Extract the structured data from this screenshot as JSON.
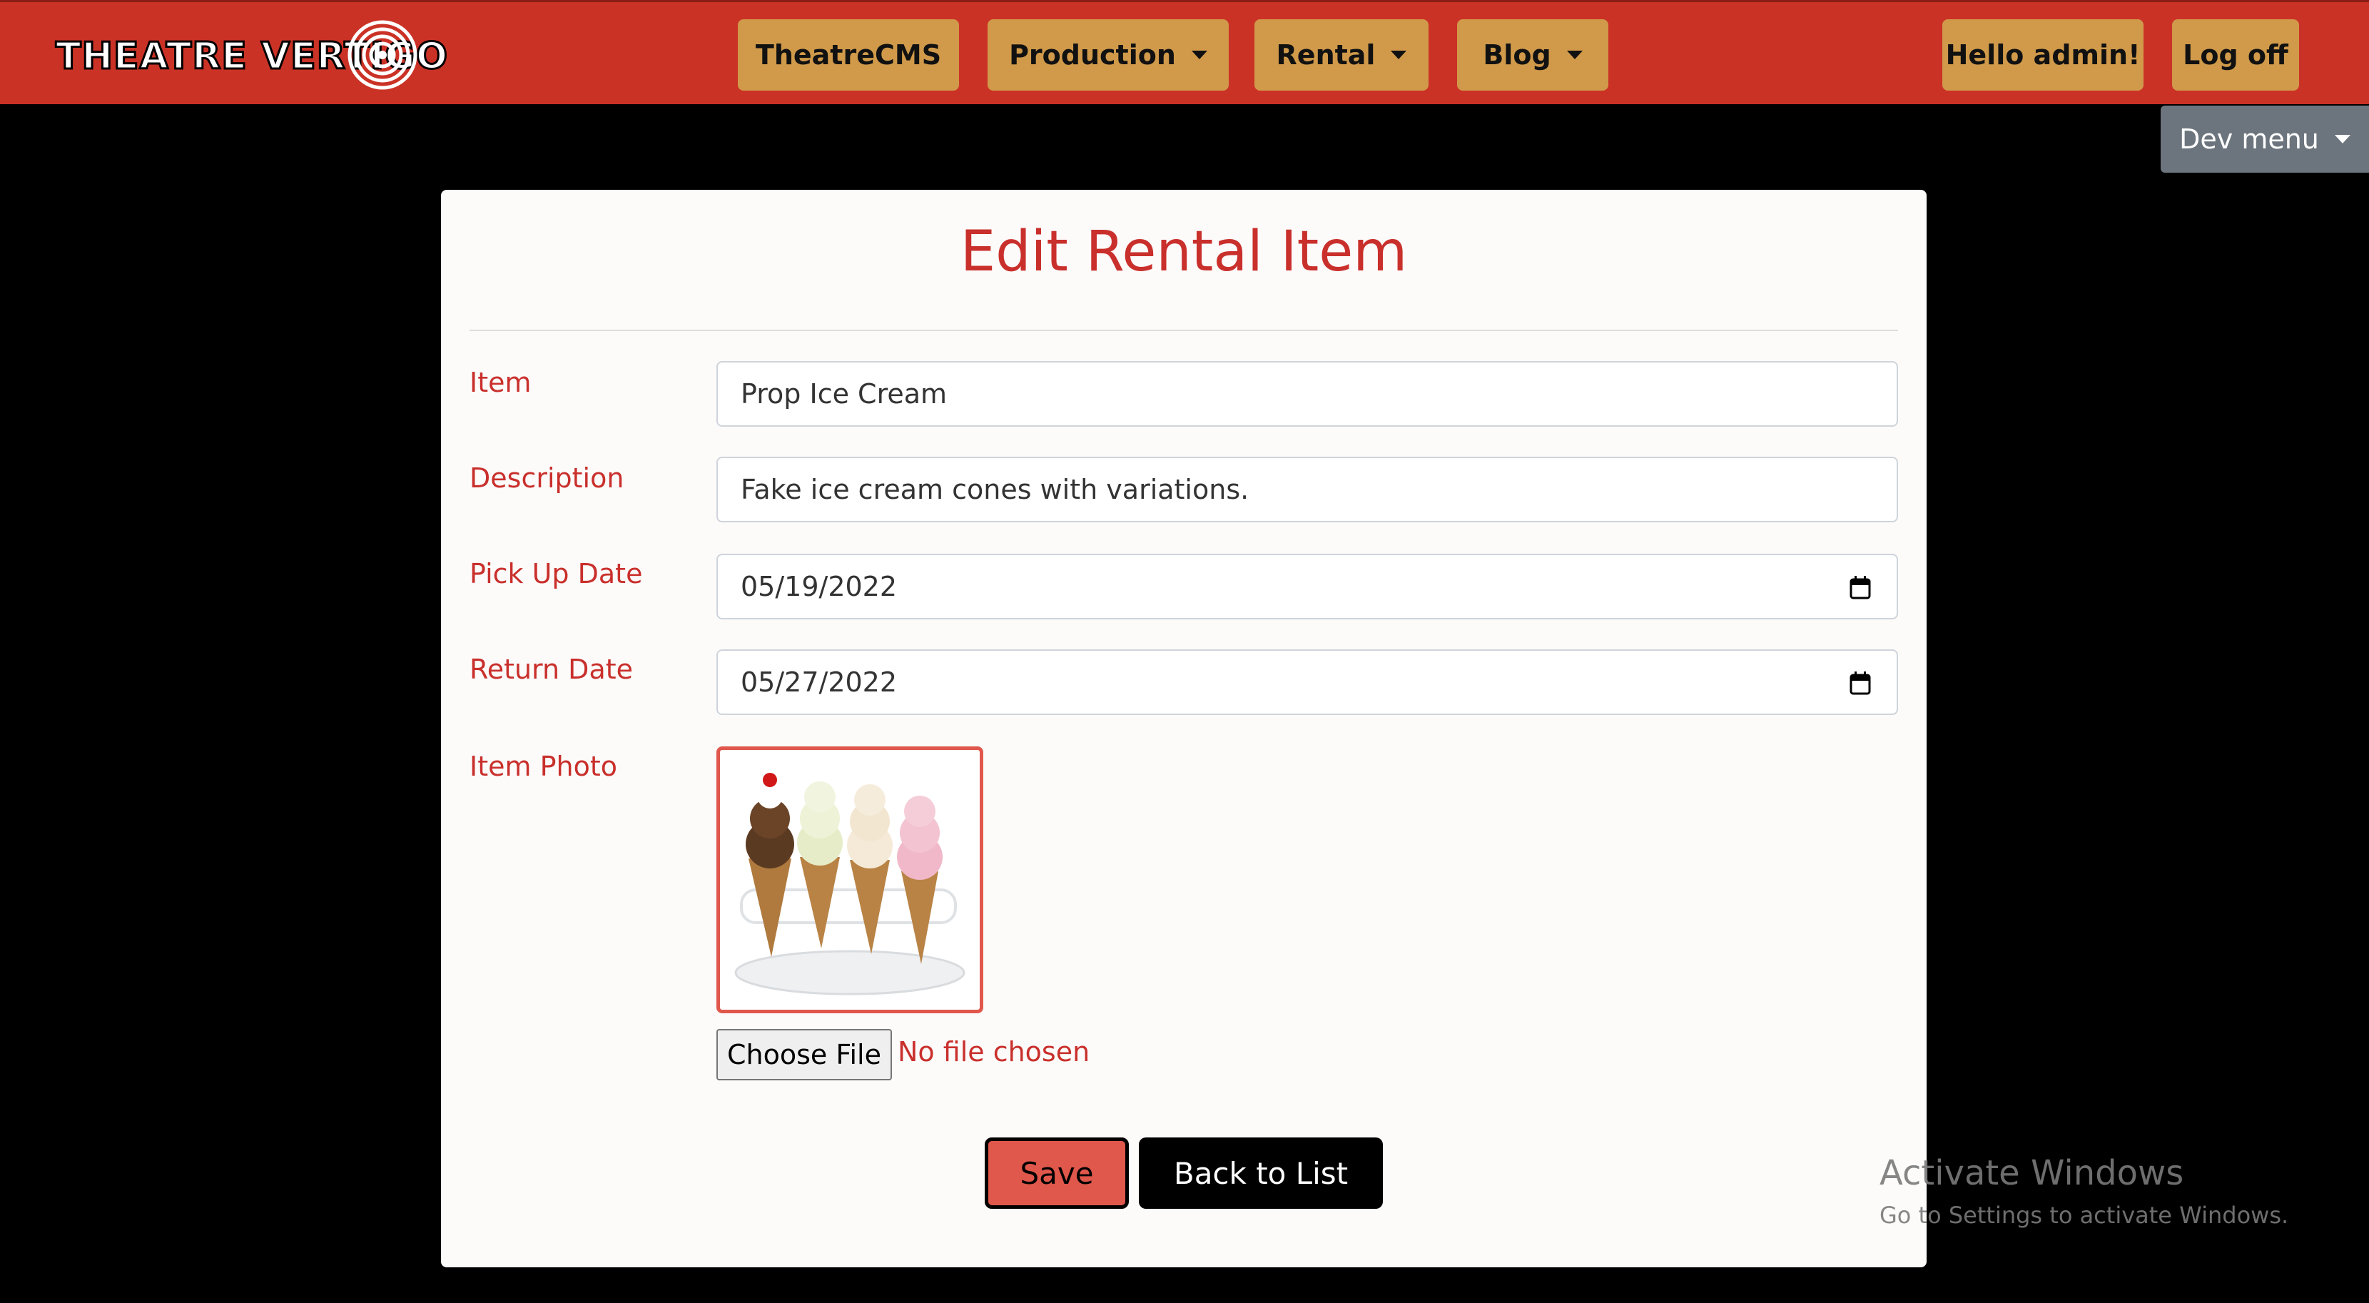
{
  "brand": {
    "logo_text": "THEATRE VERTIGO"
  },
  "nav": {
    "items": [
      {
        "label": "TheatreCMS",
        "dropdown": false
      },
      {
        "label": "Production",
        "dropdown": true
      },
      {
        "label": "Rental",
        "dropdown": true
      },
      {
        "label": "Blog",
        "dropdown": true
      }
    ],
    "greeting": "Hello admin!",
    "logoff": "Log off",
    "dev_menu": "Dev menu"
  },
  "form": {
    "title": "Edit Rental Item",
    "fields": {
      "item": {
        "label": "Item",
        "value": "Prop Ice Cream"
      },
      "description": {
        "label": "Description",
        "value": "Fake ice cream cones with variations."
      },
      "pickup": {
        "label": "Pick Up Date",
        "value": "05/19/2022"
      },
      "return": {
        "label": "Return Date",
        "value": "05/27/2022"
      },
      "photo": {
        "label": "Item Photo"
      }
    },
    "file_button": "Choose File",
    "file_status": "No file chosen",
    "save": "Save",
    "back": "Back to List"
  },
  "watermark": {
    "title": "Activate Windows",
    "subtitle": "Go to Settings to activate Windows."
  },
  "colors": {
    "navbar": "#cb3226",
    "nav_button": "#d09a4a",
    "accent_text": "#c9302c",
    "save_button": "#e0574b",
    "dev_menu": "#6c757d"
  }
}
